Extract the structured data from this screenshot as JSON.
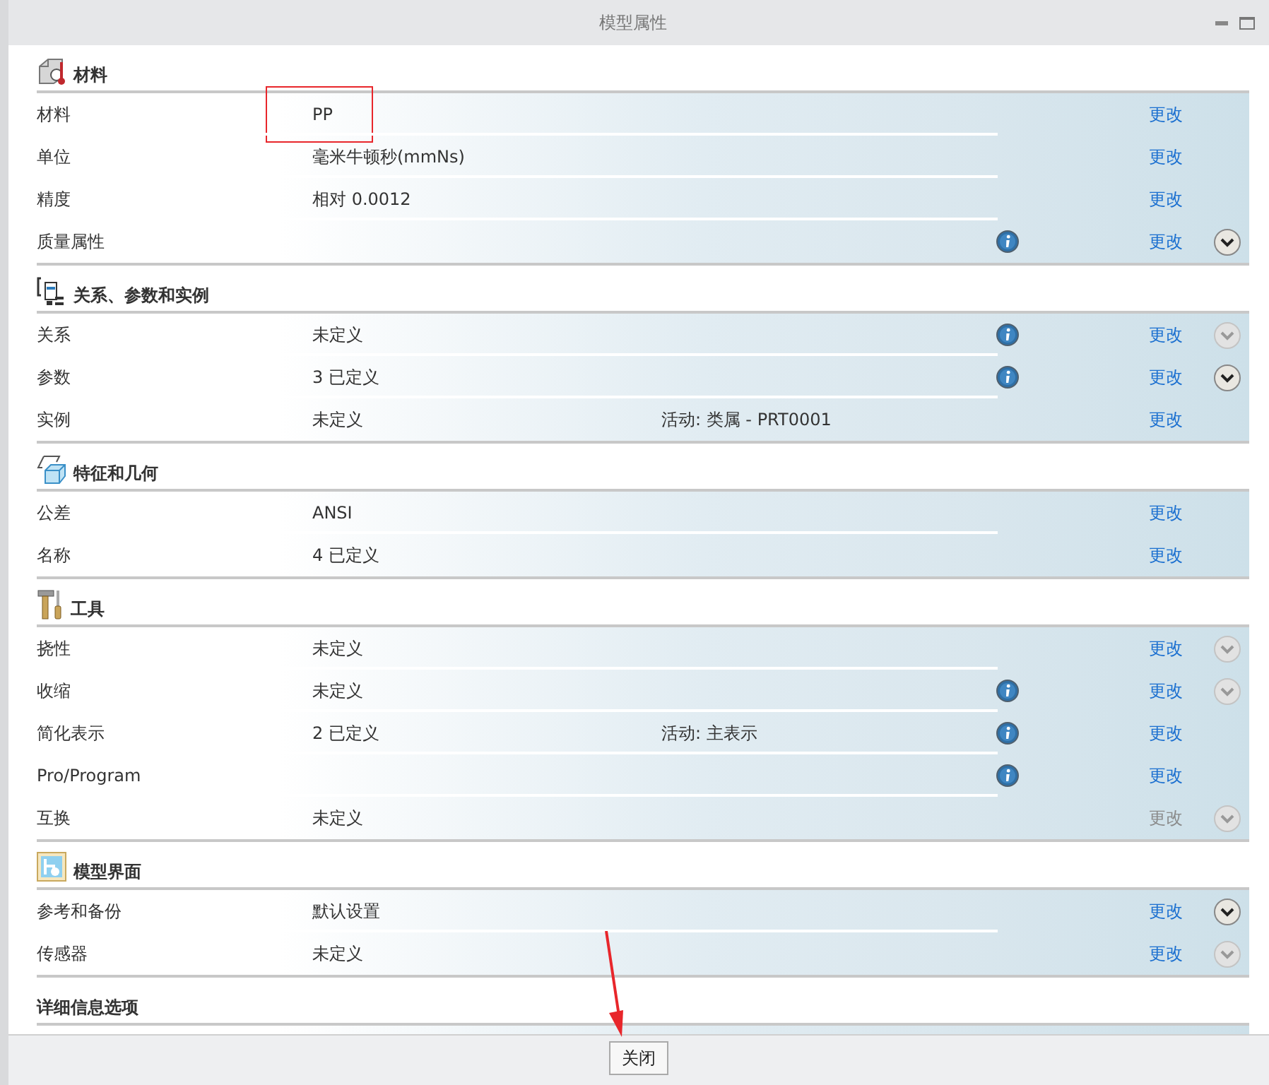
{
  "window": {
    "title": "模型属性"
  },
  "sections": [
    {
      "title": "材料",
      "rows": [
        {
          "label": "材料",
          "value": "PP",
          "highlighted": true,
          "info": false,
          "link": {
            "label": "更改",
            "disabled": false
          }
        },
        {
          "label": "单位",
          "value": "毫米牛顿秒(mmNs)",
          "info": false,
          "link": {
            "label": "更改",
            "disabled": false
          }
        },
        {
          "label": "精度",
          "value": "相对 0.0012",
          "info": false,
          "link": {
            "label": "更改",
            "disabled": false
          }
        },
        {
          "label": "质量属性",
          "info": true,
          "link": {
            "label": "更改",
            "disabled": false
          },
          "expander": {
            "enabled": true
          }
        }
      ]
    },
    {
      "title": "关系、参数和实例",
      "rows": [
        {
          "label": "关系",
          "value": "未定义",
          "info": true,
          "link": {
            "label": "更改",
            "disabled": false
          },
          "expander": {
            "enabled": false
          }
        },
        {
          "label": "参数",
          "value": "3 已定义",
          "info": true,
          "link": {
            "label": "更改",
            "disabled": false
          },
          "expander": {
            "enabled": true
          }
        },
        {
          "label": "实例",
          "value": "未定义",
          "note": "活动: 类属 - PRT0001",
          "info": false,
          "link": {
            "label": "更改",
            "disabled": false
          }
        }
      ]
    },
    {
      "title": "特征和几何",
      "rows": [
        {
          "label": "公差",
          "value": "ANSI",
          "info": false,
          "link": {
            "label": "更改",
            "disabled": false
          }
        },
        {
          "label": "名称",
          "value": "4 已定义",
          "info": false,
          "link": {
            "label": "更改",
            "disabled": false
          }
        }
      ]
    },
    {
      "title": "工具",
      "rows": [
        {
          "label": "挠性",
          "value": "未定义",
          "info": false,
          "link": {
            "label": "更改",
            "disabled": false
          },
          "expander": {
            "enabled": false
          }
        },
        {
          "label": "收缩",
          "value": "未定义",
          "info": true,
          "link": {
            "label": "更改",
            "disabled": false
          },
          "expander": {
            "enabled": false
          }
        },
        {
          "label": "简化表示",
          "value": "2 已定义",
          "note": "活动: 主表示",
          "info": true,
          "link": {
            "label": "更改",
            "disabled": false
          }
        },
        {
          "label": "Pro/Program",
          "info": true,
          "link": {
            "label": "更改",
            "disabled": false
          }
        },
        {
          "label": "互换",
          "value": "未定义",
          "info": false,
          "link": {
            "label": "更改",
            "disabled": true
          },
          "expander": {
            "enabled": false
          }
        }
      ]
    },
    {
      "title": "模型界面",
      "rows": [
        {
          "label": "参考和备份",
          "value": "默认设置",
          "info": false,
          "link": {
            "label": "更改",
            "disabled": false
          },
          "expander": {
            "enabled": true
          }
        },
        {
          "label": "传感器",
          "value": "未定义",
          "info": false,
          "link": {
            "label": "更改",
            "disabled": false
          },
          "expander": {
            "enabled": false
          }
        }
      ]
    },
    {
      "title": "详细信息选项"
    }
  ],
  "footer": {
    "button": "关闭",
    "arrow_pointing": true
  }
}
